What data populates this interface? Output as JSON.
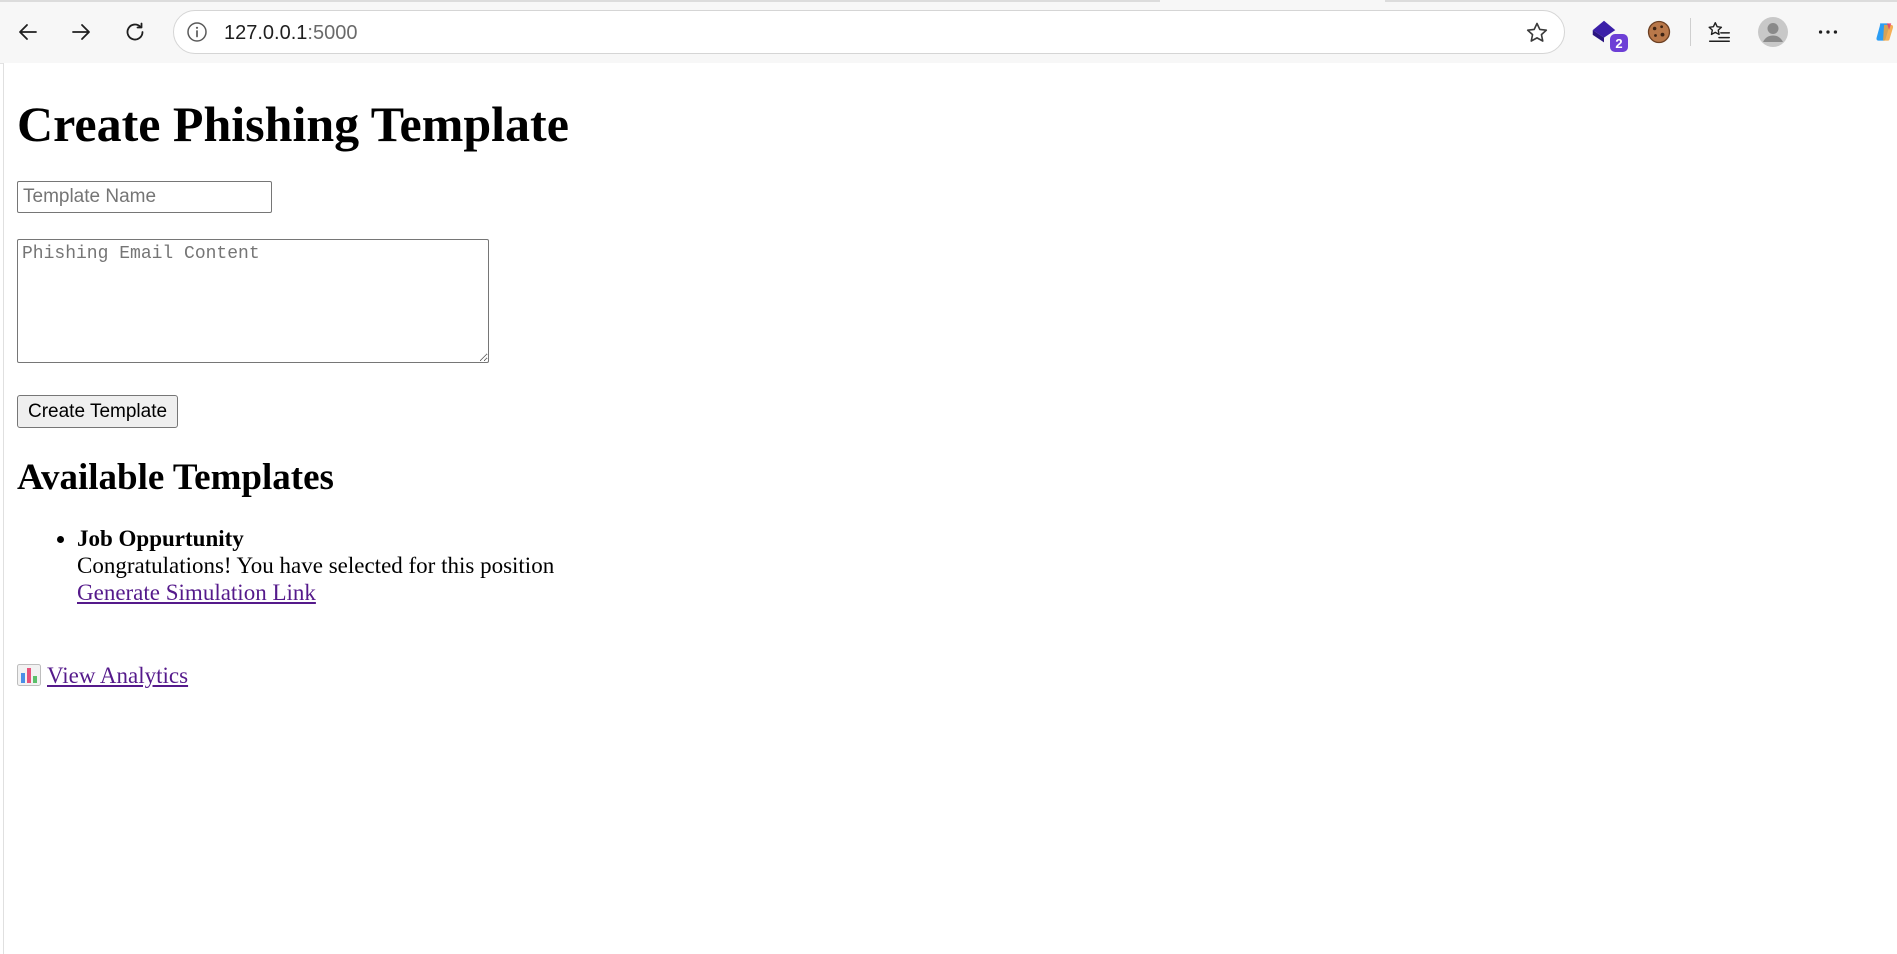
{
  "browser": {
    "url_host": "127.0.0.1",
    "url_port": ":5000",
    "extension_badge_count": "2"
  },
  "page": {
    "title": "Create Phishing Template",
    "form": {
      "name_placeholder": "Template Name",
      "content_placeholder": "Phishing Email Content",
      "submit_label": "Create Template"
    },
    "templates_heading": "Available Templates",
    "templates": [
      {
        "name": "Job Oppurtunity",
        "body": "Congratulations! You have selected for this position",
        "action_label": "Generate Simulation Link"
      }
    ],
    "analytics_label": "View Analytics"
  },
  "colors": {
    "link_visited": "#551a8b",
    "extension_accent": "#6d3fd6"
  },
  "icons": {
    "analytics": "bar-chart-emoji"
  }
}
